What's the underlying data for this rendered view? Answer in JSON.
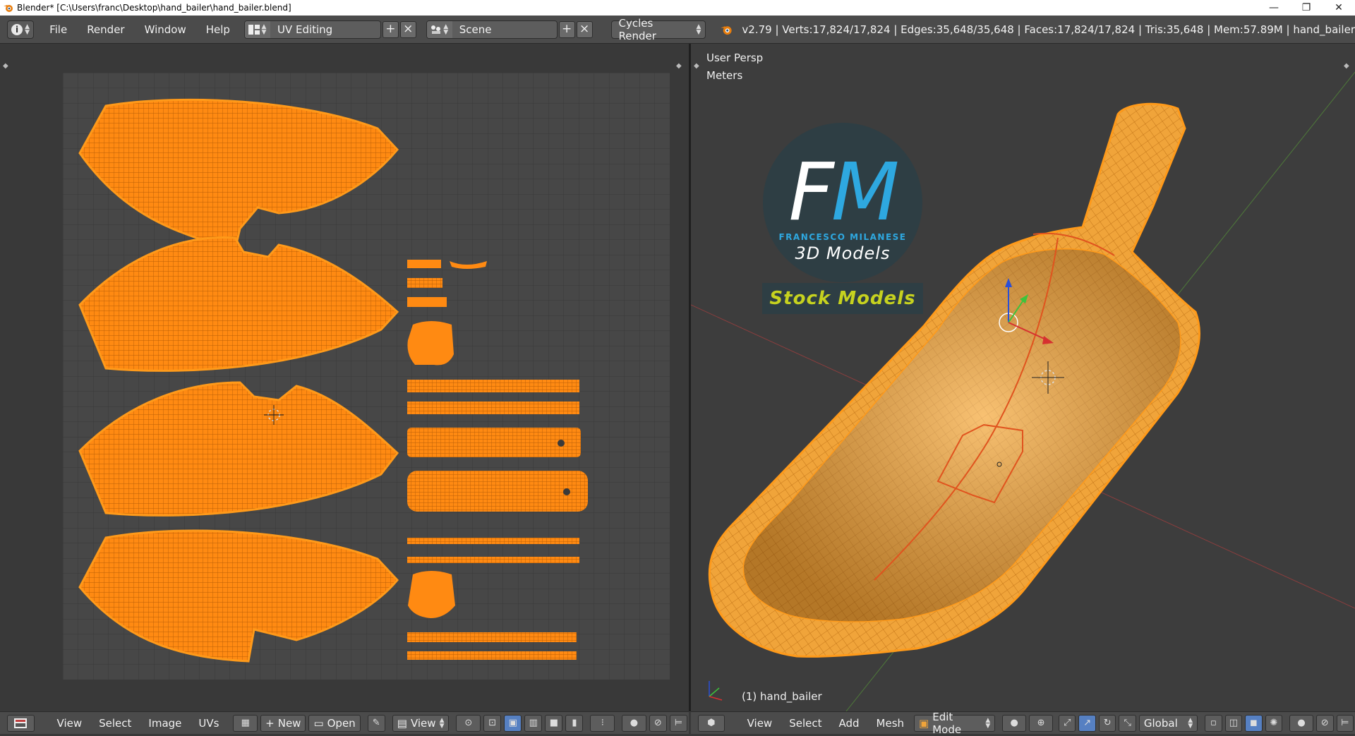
{
  "window": {
    "title": "Blender* [C:\\Users\\franc\\Desktop\\hand_bailer\\hand_bailer.blend]",
    "minimize": "—",
    "maximize": "❐",
    "close": "✕"
  },
  "info_header": {
    "menus": [
      "File",
      "Render",
      "Window",
      "Help"
    ],
    "screen_layout": "UV Editing",
    "scene": "Scene",
    "render_engine": "Cycles Render",
    "stats": "v2.79 | Verts:17,824/17,824 | Edges:35,648/35,648 | Faces:17,824/17,824 | Tris:35,648 | Mem:57.89M | hand_bailer"
  },
  "uv_footer": {
    "menus": [
      "View",
      "Select",
      "Image",
      "UVs"
    ],
    "new_label": "New",
    "open_label": "Open",
    "view_label": "View"
  },
  "viewport": {
    "view_name": "User Persp",
    "units": "Meters",
    "object_label": "(1) hand_bailer"
  },
  "vp_footer": {
    "menus": [
      "View",
      "Select",
      "Add",
      "Mesh"
    ],
    "mode": "Edit Mode",
    "orientation": "Global"
  },
  "logo": {
    "letter_f": "F",
    "letter_m": "M",
    "name": "FRANCESCO MILANESE",
    "subtitle": "3D Models",
    "banner": "Stock Models"
  },
  "colors": {
    "uv_mesh": "#ff8a12",
    "selected_edge": "#ff9a1a",
    "accent_blue": "#2ea8e0",
    "banner_yellow": "#c6d21f"
  }
}
